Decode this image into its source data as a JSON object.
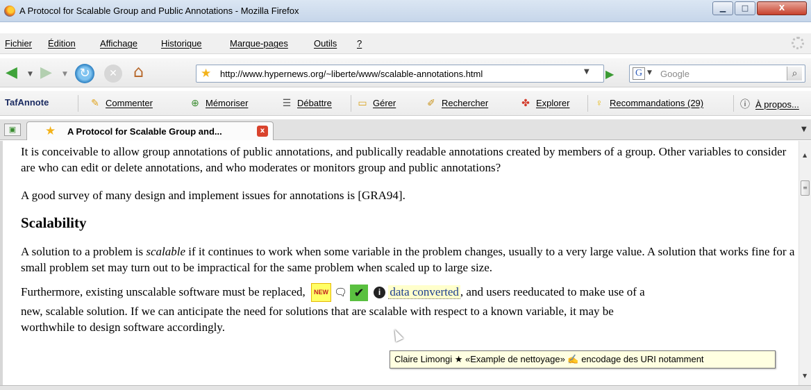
{
  "window": {
    "title": "A Protocol for Scalable Group and Public Annotations - Mozilla Firefox",
    "min_glyph": "▁",
    "max_glyph": "□",
    "close_glyph": "X"
  },
  "menu": [
    "Fichier",
    "Édition",
    "Affichage",
    "Historique",
    "Marque-pages",
    "Outils",
    "?"
  ],
  "nav": {
    "url": "http://www.hypernews.org/~liberte/www/scalable-annotations.html",
    "search_engine": "G",
    "search_placeholder": "Google"
  },
  "extension_bar": {
    "brand": "TafAnnote",
    "buttons": [
      {
        "label": "Commenter",
        "icon": "pen-icon"
      },
      {
        "label": "Mémoriser",
        "icon": "bookmark-plus-icon"
      },
      {
        "label": "Débattre",
        "icon": "list-icon"
      },
      {
        "label": "Gérer",
        "icon": "folder-icon"
      },
      {
        "label": "Rechercher",
        "icon": "search-pen-icon"
      },
      {
        "label": "Explorer",
        "icon": "explore-icon"
      },
      {
        "label": "Recommandations (29)",
        "icon": "lightbulb-icon"
      },
      {
        "label": "À propos...",
        "icon": "help-icon"
      }
    ]
  },
  "tab": {
    "title": "A Protocol for Scalable Group and...",
    "close": "x"
  },
  "content": {
    "p1": "It is conceivable to allow group annotations of public annotations, and publically readable annotations created by members of a group. Other variables to consider are who can edit or delete annotations, and who moderates or monitors group and public annotations?",
    "p2": "A good survey of many design and implement issues for annotations is [GRA94].",
    "heading": "Scalability",
    "p3_before": "A solution to a problem is ",
    "p3_em": "scalable",
    "p3_after": " if it continues to work when some variable in the problem changes, usually to a very large value. A solution that works fine for a small problem set may turn out to be impractical for the same problem when scaled up to large size.",
    "p4_before": "Furthermore, existing unscalable software must be replaced,",
    "new_badge": "NEW",
    "check_glyph": "✔",
    "info_glyph": "i",
    "highlight_text": "data converted",
    "p4_after": ", and users reeducated to make use of a",
    "p5_line1": "new, scalable solution. If we can anticipate the need for solutions that are scalable with respect to a known variable, it may be",
    "p5_line2": "worthwhile to design software accordingly."
  },
  "tooltip": "Claire Limongi ★ «Example de nettoyage» ✍ encodage des URI notamment"
}
